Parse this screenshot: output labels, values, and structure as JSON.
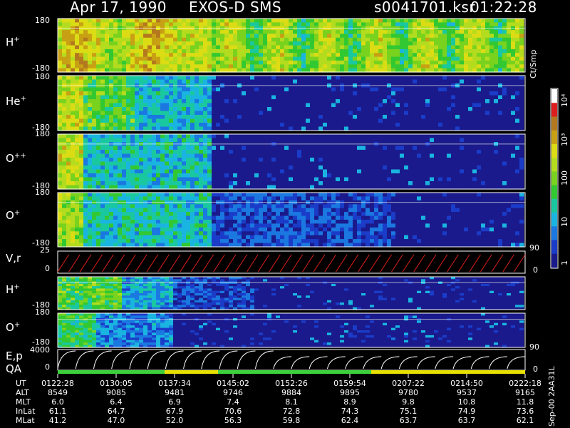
{
  "header": {
    "date": "Apr 17, 1990",
    "instrument": "EXOS-D SMS",
    "file": "s0041701.ksr",
    "time": "01:22:28"
  },
  "panels": [
    {
      "id": "h_plus_1",
      "label": "H",
      "sup": "+",
      "ymax": "180",
      "ymin": "-180"
    },
    {
      "id": "he_plus",
      "label": "He",
      "sup": "+",
      "ymax": "180",
      "ymin": "-180"
    },
    {
      "id": "o_pp",
      "label": "O",
      "sup": "++",
      "ymax": "180",
      "ymin": "-180"
    },
    {
      "id": "o_plus_1",
      "label": "O",
      "sup": "+",
      "ymax": "180",
      "ymin": "-180"
    },
    {
      "id": "vr",
      "label": "V,r",
      "sup": "",
      "ymax": "25",
      "ymin": "0",
      "rmax": "90",
      "rmin": "0"
    },
    {
      "id": "h_plus_2",
      "label": "H",
      "sup": "+",
      "ymax": "180",
      "ymin": "-180"
    },
    {
      "id": "o_plus_2",
      "label": "O",
      "sup": "+",
      "ymax": "180",
      "ymin": "-180"
    },
    {
      "id": "ep",
      "label": "E,p",
      "label2": "QA",
      "ymax": "4000",
      "ymin": "0",
      "rmax": "90",
      "rmin": "0"
    }
  ],
  "colorbar": {
    "unit": "Ct/Smp",
    "labels": [
      "10⁴",
      "10³",
      "100",
      "10",
      "1"
    ]
  },
  "side_note": "Sep-00 2AA31L",
  "ephemeris": {
    "rows": [
      {
        "label": "UT",
        "values": [
          "0122:28",
          "0130:05",
          "0137:34",
          "0145:02",
          "0152:26",
          "0159:54",
          "0207:22",
          "0214:50",
          "0222:18"
        ]
      },
      {
        "label": "ALT",
        "values": [
          "8549",
          "9085",
          "9481",
          "9746",
          "9884",
          "9895",
          "9780",
          "9537",
          "9165"
        ]
      },
      {
        "label": "MLT",
        "values": [
          "6.0",
          "6.4",
          "6.9",
          "7.4",
          "8.1",
          "8.9",
          "9.8",
          "10.8",
          "11.8"
        ]
      },
      {
        "label": "InLat",
        "values": [
          "61.1",
          "64.7",
          "67.9",
          "70.6",
          "72.8",
          "74.3",
          "75.1",
          "74.9",
          "73.6"
        ]
      },
      {
        "label": "MLat",
        "values": [
          "41.2",
          "47.0",
          "52.0",
          "56.3",
          "59.8",
          "62.4",
          "63.7",
          "63.7",
          "62.1"
        ]
      }
    ]
  },
  "colors": {
    "background": "#000000",
    "axis": "#ffffff",
    "velocity_trace": "#e0201a",
    "qa_green": "#3cd23c",
    "qa_yellow": "#e8e000"
  },
  "chart_data": {
    "type": "heatmap",
    "x_axis": "UT",
    "x_ticks": [
      "0122:28",
      "0130:05",
      "0137:34",
      "0145:02",
      "0152:26",
      "0159:54",
      "0207:22",
      "0214:50",
      "0222:18"
    ],
    "colorbar_scale": "log",
    "colorbar_range": [
      1,
      10000
    ],
    "note": "Energy-angle spectrogram panels (H+, He+, O++, O+, H+, O+) with pitch angle -180 to 180; V,r line panel; E,p line panel with QA bar."
  }
}
